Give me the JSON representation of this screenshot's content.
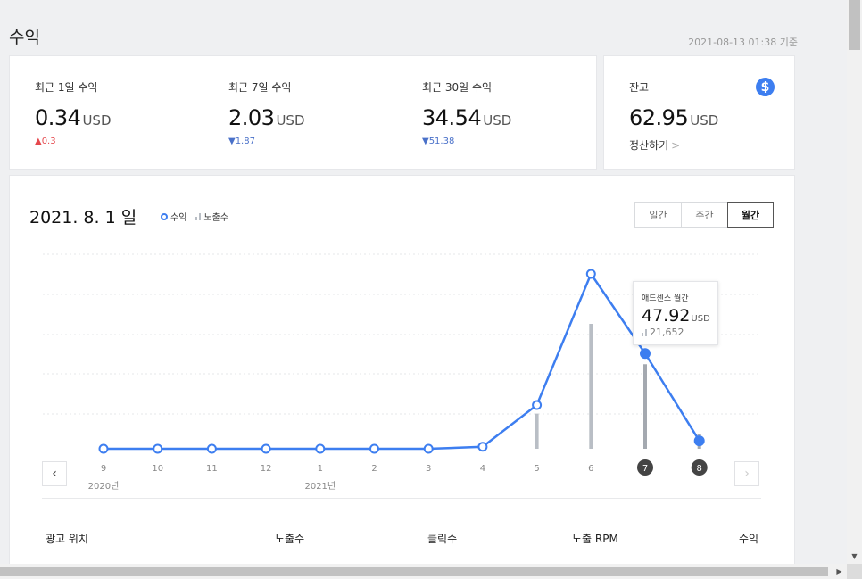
{
  "header": {
    "title": "수익",
    "timestamp": "2021-08-13 01:38 기준"
  },
  "summary": [
    {
      "label": "최근 1일 수익",
      "value": "0.34",
      "unit": "USD",
      "delta": "▲0.3",
      "direction": "up"
    },
    {
      "label": "최근 7일 수익",
      "value": "2.03",
      "unit": "USD",
      "delta": "▼1.87",
      "direction": "down"
    },
    {
      "label": "최근 30일 수익",
      "value": "34.54",
      "unit": "USD",
      "delta": "▼51.38",
      "direction": "down"
    }
  ],
  "balance": {
    "label": "잔고",
    "value": "62.95",
    "unit": "USD",
    "settle_label": "정산하기",
    "settle_chevron": ">",
    "icon": "dollar-icon",
    "icon_glyph": "$"
  },
  "chart": {
    "date_label": "2021. 8. 1 일",
    "legend": {
      "revenue": "수익",
      "impressions": "노출수"
    },
    "tabs": [
      "일간",
      "주간",
      "월간"
    ],
    "active_tab": "월간",
    "prev_glyph": "‹",
    "next_glyph": "›",
    "tooltip": {
      "title": "애드센스 월간",
      "value": "47.92",
      "unit": "USD",
      "impressions": "21,652"
    },
    "year_labels": [
      {
        "year": "2020년",
        "at_index": 0
      },
      {
        "year": "2021년",
        "at_index": 4
      }
    ],
    "colors": {
      "line": "#3d7ef0",
      "bar": "#b9bec5",
      "highlight_bar": "#a4a9b0",
      "badge": "#444444"
    }
  },
  "chart_data": {
    "type": "line",
    "x": [
      "9",
      "10",
      "11",
      "12",
      "1",
      "2",
      "3",
      "4",
      "5",
      "6",
      "7",
      "8"
    ],
    "series": [
      {
        "name": "수익",
        "values": [
          0,
          0,
          0,
          0,
          0,
          0,
          0,
          1,
          22,
          88,
          47.92,
          4
        ]
      },
      {
        "name": "노출수",
        "values": [
          0,
          0,
          0,
          0,
          0,
          0,
          0,
          0,
          9000,
          32000,
          21652,
          3800
        ]
      }
    ],
    "highlighted_indices": [
      10,
      11
    ],
    "grid": true
  },
  "table": {
    "headers": [
      "광고 위치",
      "노출수",
      "클릭수",
      "노출 RPM",
      "수익"
    ]
  },
  "scrollbars": {
    "up": "▲",
    "down": "▼",
    "right": "▶"
  }
}
